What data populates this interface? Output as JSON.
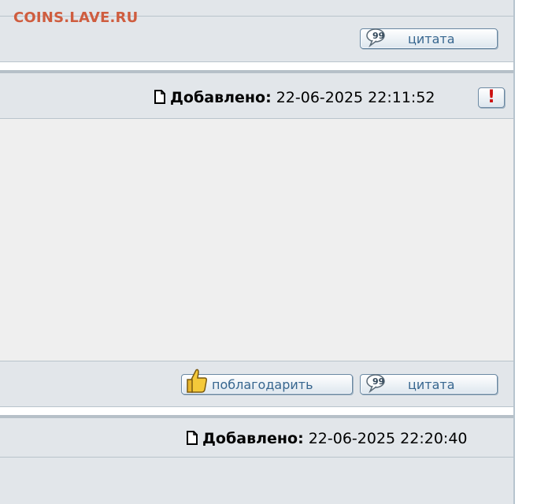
{
  "site": {
    "logo_text": "COINS.LAVE.RU"
  },
  "post1": {
    "quote_label": "цитата"
  },
  "post2": {
    "added_label": "Добавлено:",
    "added_time": "22-06-2025 22:11:52",
    "report_glyph": "!",
    "thank_label": "поблагодарить",
    "quote_label": "цитата"
  },
  "post3": {
    "added_label": "Добавлено:",
    "added_time": "22-06-2025 22:20:40"
  },
  "colors": {
    "logo": "#cf5d3f",
    "bar": "#e2e6ea",
    "post_body": "#efefef",
    "button_text": "#37668f",
    "report_mark": "#cc1111"
  }
}
